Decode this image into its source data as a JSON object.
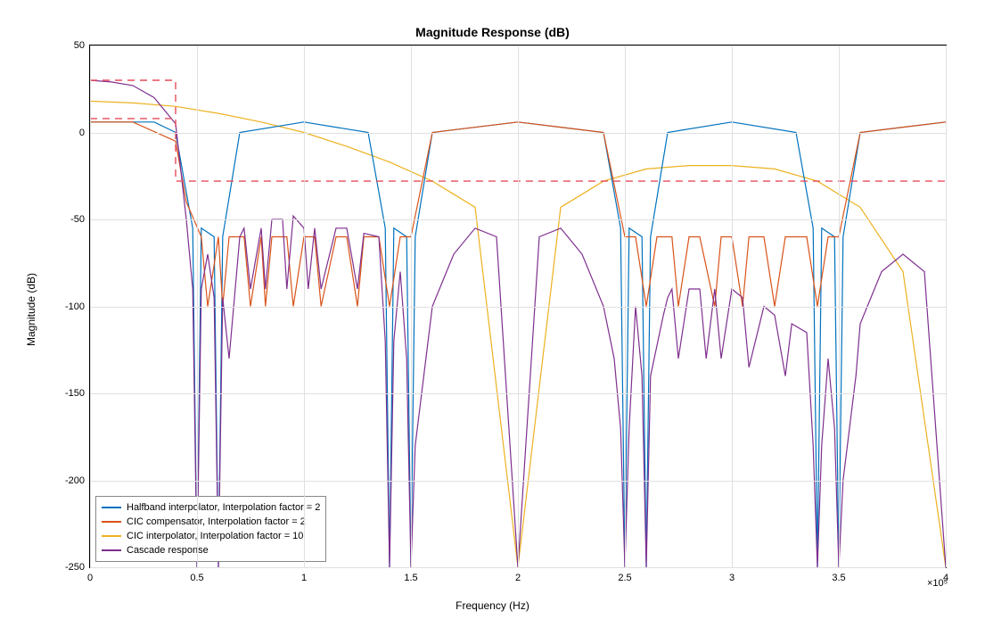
{
  "chart_data": {
    "type": "line",
    "title": "Magnitude Response (dB)",
    "xlabel": "Frequency (Hz)",
    "ylabel": "Magnitude (dB)",
    "xlim": [
      0,
      400000
    ],
    "ylim": [
      -250,
      50
    ],
    "x_exponent_label": "×10⁵",
    "x_ticks": [
      0,
      0.5,
      1,
      1.5,
      2,
      2.5,
      3,
      3.5,
      4
    ],
    "y_ticks": [
      50,
      0,
      -50,
      -100,
      -150,
      -200,
      -250
    ],
    "legend": [
      "Halfband interpolator, Interpolation factor = 2",
      "CIC compensator, Interpolation factor = 2",
      "CIC interpolator, Interpolation factor = 10",
      "Cascade response"
    ],
    "colors": {
      "halfband": "#0072BD",
      "cic_comp": "#D95319",
      "cic_interp": "#EDB120",
      "cascade": "#7E2F8E",
      "mask": "#E74C5C"
    },
    "mask": [
      {
        "x": 0,
        "y": 30
      },
      {
        "x": 40000,
        "y": 30
      },
      {
        "x": 40000,
        "y": -28
      },
      {
        "x": 400000,
        "y": -28
      }
    ],
    "mask_lower": [
      {
        "x": 0,
        "y": 8
      },
      {
        "x": 40000,
        "y": 8
      }
    ],
    "series": [
      {
        "name": "CIC interpolator, Interpolation factor = 10",
        "color": "#EDB120",
        "x": [
          0,
          20000,
          40000,
          60000,
          80000,
          100000,
          120000,
          140000,
          160000,
          180000,
          200000,
          220000,
          240000,
          260000,
          280000,
          300000,
          320000,
          340000,
          360000,
          380000,
          400000
        ],
        "y": [
          18,
          17,
          15,
          11,
          6,
          0,
          -8,
          -17,
          -28,
          -43,
          -250,
          -43,
          -28,
          -21,
          -19,
          -19,
          -21,
          -28,
          -43,
          -80,
          -250
        ]
      },
      {
        "name": "Halfband interpolator, Interpolation factor = 2",
        "color": "#0072BD",
        "x": [
          0,
          30000,
          40000,
          48000,
          50000,
          52000,
          58000,
          60000,
          62000,
          70000,
          100000,
          130000,
          138000,
          140000,
          142000,
          148000,
          150000,
          152000,
          160000,
          200000,
          240000,
          248000,
          250000,
          252000,
          258000,
          260000,
          262000,
          270000,
          300000,
          330000,
          338000,
          340000,
          342000,
          348000,
          350000,
          352000,
          360000,
          400000
        ],
        "y": [
          6,
          6,
          0,
          -55,
          -250,
          -55,
          -60,
          -250,
          -60,
          0,
          6,
          0,
          -55,
          -250,
          -55,
          -60,
          -250,
          -60,
          0,
          6,
          0,
          -55,
          -250,
          -55,
          -60,
          -250,
          -60,
          0,
          6,
          0,
          -55,
          -250,
          -55,
          -60,
          -250,
          -60,
          0,
          6
        ]
      },
      {
        "name": "CIC compensator, Interpolation factor = 2",
        "color": "#D95319",
        "x": [
          0,
          20000,
          40000,
          45000,
          52000,
          55000,
          60000,
          62000,
          65000,
          72000,
          75000,
          80000,
          82000,
          85000,
          92000,
          95000,
          100000,
          105000,
          108000,
          115000,
          120000,
          125000,
          128000,
          135000,
          140000,
          145000,
          150000,
          160000,
          200000,
          240000,
          250000,
          255000,
          260000,
          265000,
          272000,
          275000,
          280000,
          285000,
          292000,
          295000,
          300000,
          305000,
          308000,
          315000,
          320000,
          325000,
          328000,
          335000,
          340000,
          345000,
          350000,
          360000,
          400000
        ],
        "y": [
          6,
          6,
          -5,
          -40,
          -60,
          -100,
          -60,
          -100,
          -60,
          -60,
          -100,
          -60,
          -100,
          -60,
          -60,
          -100,
          -60,
          -60,
          -100,
          -60,
          -60,
          -100,
          -60,
          -60,
          -100,
          -60,
          -60,
          0,
          6,
          0,
          -60,
          -60,
          -100,
          -60,
          -60,
          -100,
          -60,
          -60,
          -100,
          -60,
          -60,
          -100,
          -60,
          -60,
          -100,
          -60,
          -60,
          -60,
          -100,
          -60,
          -60,
          0,
          6
        ]
      },
      {
        "name": "Cascade response",
        "color": "#7E2F8E",
        "x": [
          0,
          10000,
          20000,
          30000,
          40000,
          45000,
          48000,
          50000,
          52000,
          55000,
          58000,
          60000,
          62000,
          65000,
          70000,
          72000,
          75000,
          80000,
          82000,
          85000,
          90000,
          92000,
          95000,
          100000,
          102000,
          105000,
          108000,
          115000,
          120000,
          125000,
          128000,
          135000,
          138000,
          140000,
          142000,
          145000,
          148000,
          150000,
          152000,
          158000,
          160000,
          170000,
          180000,
          190000,
          200000,
          210000,
          220000,
          230000,
          240000,
          245000,
          248000,
          250000,
          252000,
          255000,
          258000,
          260000,
          262000,
          268000,
          270000,
          272000,
          275000,
          280000,
          285000,
          288000,
          292000,
          295000,
          300000,
          305000,
          308000,
          315000,
          320000,
          325000,
          328000,
          335000,
          338000,
          340000,
          342000,
          345000,
          348000,
          350000,
          352000,
          358000,
          360000,
          370000,
          380000,
          390000,
          400000
        ],
        "y": [
          30,
          29,
          27,
          20,
          5,
          -50,
          -90,
          -250,
          -90,
          -70,
          -95,
          -250,
          -95,
          -130,
          -60,
          -55,
          -90,
          -55,
          -90,
          -50,
          -50,
          -90,
          -48,
          -55,
          -90,
          -55,
          -90,
          -55,
          -55,
          -90,
          -58,
          -60,
          -120,
          -250,
          -120,
          -80,
          -130,
          -250,
          -180,
          -120,
          -100,
          -70,
          -55,
          -60,
          -250,
          -60,
          -55,
          -70,
          -100,
          -130,
          -170,
          -250,
          -170,
          -100,
          -140,
          -250,
          -140,
          -105,
          -95,
          -90,
          -130,
          -90,
          -90,
          -130,
          -90,
          -130,
          -90,
          -95,
          -135,
          -100,
          -105,
          -140,
          -110,
          -115,
          -180,
          -250,
          -180,
          -130,
          -170,
          -250,
          -200,
          -140,
          -110,
          -80,
          -70,
          -80,
          -250
        ]
      }
    ]
  }
}
